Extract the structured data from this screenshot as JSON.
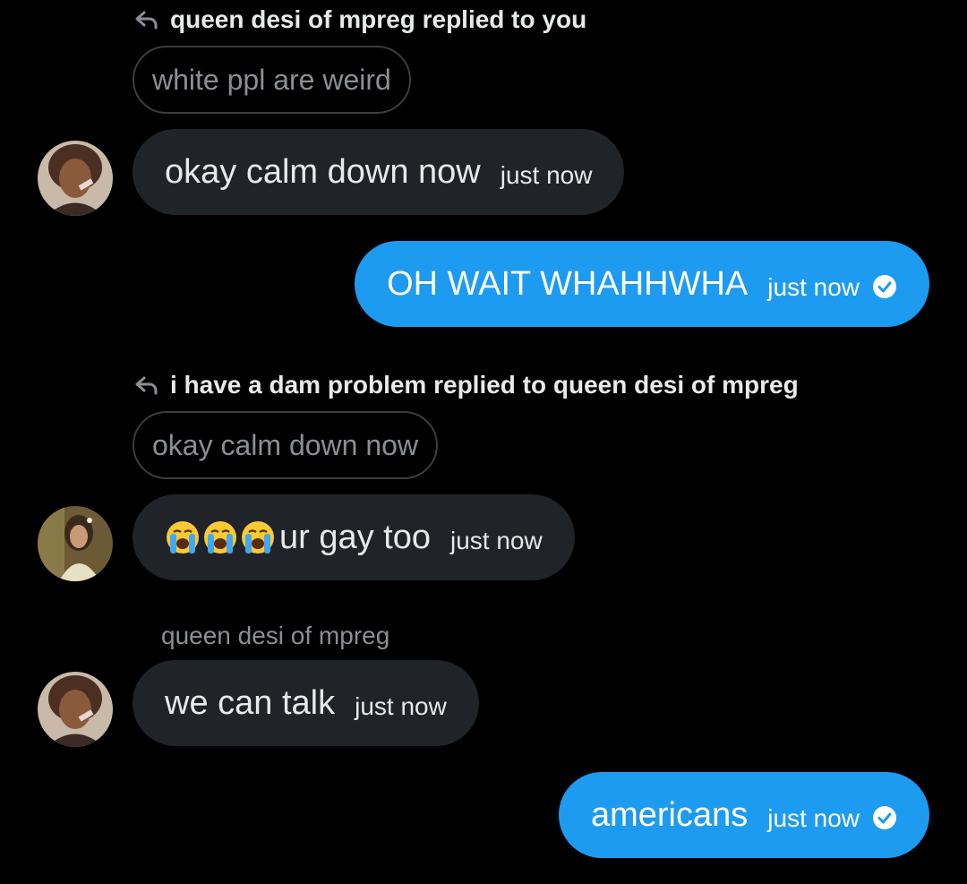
{
  "conversation": {
    "reply1": {
      "label": "queen desi of mpreg replied to you",
      "quote": "white ppl are weird"
    },
    "msg1": {
      "text": "okay calm down now",
      "time": "just now"
    },
    "msg2": {
      "text": "OH WAIT WHAHHWHA",
      "time": "just now"
    },
    "reply2": {
      "label": "i have a dam problem replied to queen desi of mpreg",
      "quote": "okay calm down now"
    },
    "msg3": {
      "text": "ur gay too",
      "time": "just now",
      "emoji": "loudly-crying-face x3"
    },
    "sender3": "queen desi of mpreg",
    "msg4": {
      "text": "we can talk",
      "time": "just now"
    },
    "msg5": {
      "text": "americans",
      "time": "just now"
    }
  },
  "colors": {
    "background": "#000000",
    "incoming_bubble": "#202327",
    "outgoing_bubble": "#1d9bf0",
    "muted_text": "#8b8f94",
    "text": "#e7e9ea"
  }
}
